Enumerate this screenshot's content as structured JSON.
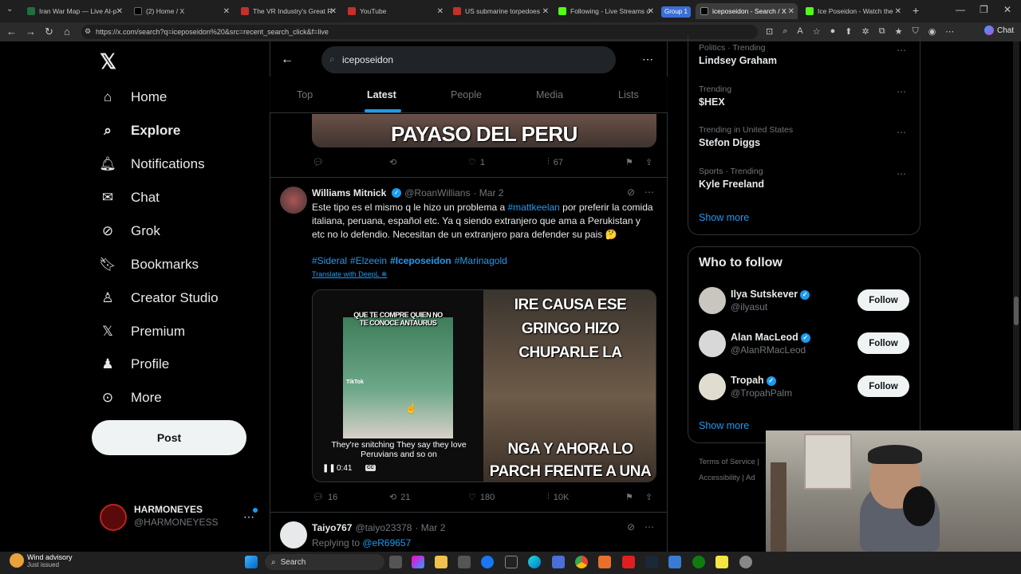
{
  "browser": {
    "tabs": [
      {
        "label": "Iran War Map — Live AI-p",
        "color": "#1f6f3f"
      },
      {
        "label": "(2) Home / X",
        "color": "#000000"
      },
      {
        "label": "The VR Industry's Great R",
        "color": "#c4302b"
      },
      {
        "label": "YouTube",
        "color": "#c4302b"
      },
      {
        "label": "US submarine torpedoes",
        "color": "#c4302b"
      },
      {
        "label": "Following - Live Streams o",
        "color": "#53fc18"
      },
      {
        "label": "iceposeidon - Search / X",
        "color": "#000000"
      },
      {
        "label": "Ice Poseidon - Watch the",
        "color": "#53fc18"
      }
    ],
    "group_label": "Group 1",
    "url": "https://x.com/search?q=iceposeidon%20&src=recent_search_click&f=live",
    "chat_label": "Chat"
  },
  "sidebar": {
    "items": [
      {
        "label": "Home"
      },
      {
        "label": "Explore"
      },
      {
        "label": "Notifications"
      },
      {
        "label": "Chat"
      },
      {
        "label": "Grok"
      },
      {
        "label": "Bookmarks"
      },
      {
        "label": "Creator Studio"
      },
      {
        "label": "Premium"
      },
      {
        "label": "Profile"
      },
      {
        "label": "More"
      }
    ],
    "post_label": "Post",
    "account": {
      "name": "HARMONEYES",
      "handle": "@HARMONEYESS"
    }
  },
  "search": {
    "query": "iceposeidon"
  },
  "tabs": [
    "Top",
    "Latest",
    "People",
    "Media",
    "Lists"
  ],
  "prev_tweet": {
    "image_text": "PAYASO DEL PERU",
    "likes": "1",
    "views": "67"
  },
  "tweet": {
    "name": "Williams Mitnick",
    "handle": "@RoanWillians",
    "date": "· Mar 2",
    "text_1": "Este tipo es el mismo q le hizo un problema a ",
    "mention": "#mattkeelan",
    "text_2": " por preferir la comida italiana, peruana, español etc. Ya q siendo extranjero que ama a Perukistan y etc no lo defendio. Necesitan de un extranjero para defender su pais 🤔",
    "tags": [
      "#Sideral",
      "#Elzeein",
      "#Iceposeidon",
      "#Marinagold"
    ],
    "translate": "Translate with DeepL",
    "video": {
      "overlay_top": "QUE TE COMPRE QUIEN NO TE CONOCE ANTAURUS",
      "tiktok": "TikTok",
      "caption": "They're snitching They say they love Peruvians and so on",
      "time": "0:41",
      "cc": "CC",
      "right_top": "IRE CAUSA ESE GRINGO HIZO CHUPARLE LA",
      "right_bottom": "NGA Y AHORA LO PARCH FRENTE A UNA CAMARA"
    },
    "replies": "16",
    "retweets": "21",
    "likes": "180",
    "views": "10K"
  },
  "next_tweet": {
    "name": "Taiyo767",
    "handle": "@taiyo23378",
    "date": "· Mar 2",
    "replying": "Replying to ",
    "replying_to": "@eR69657"
  },
  "trends": [
    {
      "category": "Politics · Trending",
      "name": "Lindsey Graham"
    },
    {
      "category": "Trending",
      "name": "$HEX"
    },
    {
      "category": "Trending in United States",
      "name": "Stefon Diggs"
    },
    {
      "category": "Sports · Trending",
      "name": "Kyle Freeland"
    }
  ],
  "show_more": "Show more",
  "who_to_follow": {
    "title": "Who to follow",
    "people": [
      {
        "name": "Ilya Sutskever",
        "handle": "@ilyasut"
      },
      {
        "name": "Alan MacLeod",
        "handle": "@AlanRMacLeod"
      },
      {
        "name": "Tropah",
        "handle": "@TropahPalm"
      }
    ],
    "follow_label": "Follow",
    "show_more": "Show more"
  },
  "footer": {
    "terms": "Terms of Service",
    "accessibility": "Accessibility",
    "ads": "Ad"
  },
  "taskbar": {
    "weather_title": "Wind advisory",
    "weather_sub": "Just issued",
    "search_label": "Search"
  }
}
